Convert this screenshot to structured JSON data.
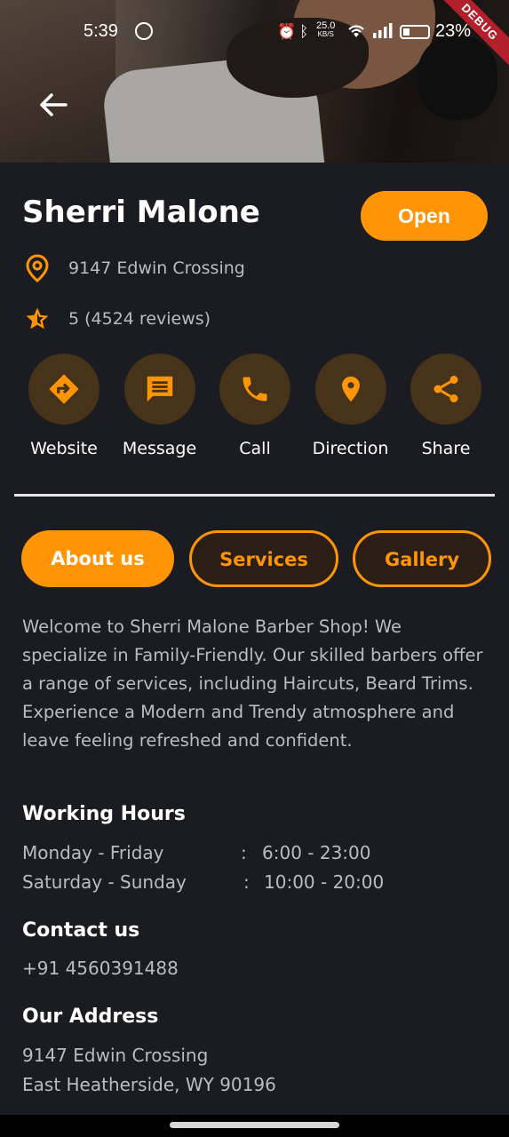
{
  "status_bar": {
    "time": "5:39",
    "speed_value": "25.0",
    "speed_unit": "KB/S",
    "battery": "23%"
  },
  "debug_banner": "DEBUG",
  "shop": {
    "name": "Sherri Malone",
    "status_label": "Open",
    "address": "9147 Edwin Crossing",
    "rating_text": "5 (4524 reviews)"
  },
  "actions": [
    {
      "label": "Website",
      "icon": "directions-icon"
    },
    {
      "label": "Message",
      "icon": "message-icon"
    },
    {
      "label": "Call",
      "icon": "phone-icon"
    },
    {
      "label": "Direction",
      "icon": "location-pin-icon"
    },
    {
      "label": "Share",
      "icon": "share-icon"
    }
  ],
  "tabs": [
    {
      "label": "About us",
      "active": true
    },
    {
      "label": "Services",
      "active": false
    },
    {
      "label": "Gallery",
      "active": false
    }
  ],
  "about_text": "Welcome to Sherri Malone Barber Shop! We specialize in Family-Friendly. Our skilled barbers offer a range of services, including Haircuts, Beard Trims. Experience a Modern and Trendy atmosphere and leave feeling refreshed and confident.",
  "working_hours": {
    "heading": "Working Hours",
    "rows": [
      {
        "days": "Monday - Friday",
        "sep": ":",
        "time": "6:00 - 23:00"
      },
      {
        "days": "Saturday - Sunday",
        "sep": ":",
        "time": "10:00 - 20:00"
      }
    ]
  },
  "contact": {
    "heading": "Contact us",
    "phone": "+91 4560391488"
  },
  "address_section": {
    "heading": "Our Address",
    "line1": "9147 Edwin Crossing",
    "line2": "East Heatherside, WY 90196"
  },
  "colors": {
    "accent": "#ff9405",
    "background": "#1b1c21",
    "action_circle": "#473319",
    "secondary_text": "#b9bcc1"
  }
}
